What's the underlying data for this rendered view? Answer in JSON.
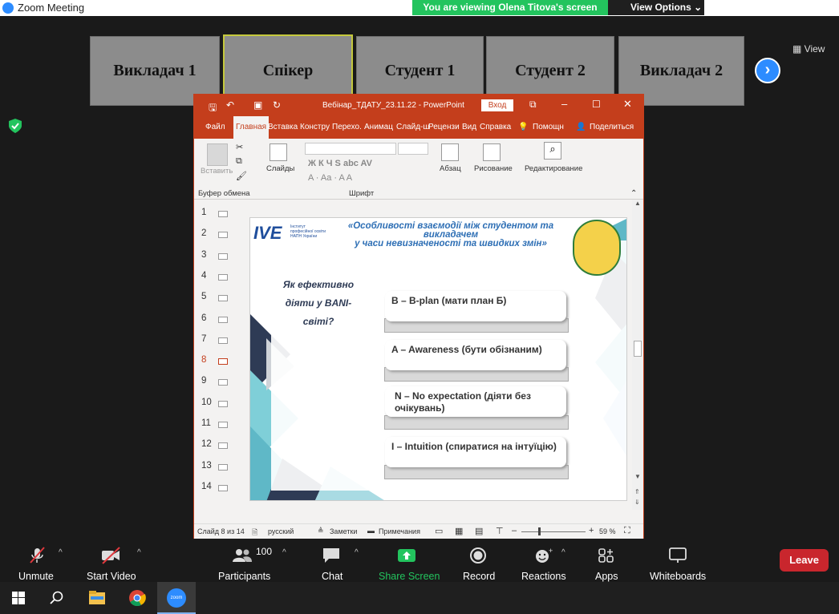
{
  "window": {
    "title": "Zoom Meeting"
  },
  "banner": {
    "viewing": "You are viewing Olena Titova's screen",
    "view_options": "View Options"
  },
  "gallery": {
    "tiles": [
      "Викладач 1",
      "Спікер",
      "Студент 1",
      "Студент 2",
      "Викладач 2"
    ],
    "view_label": "View"
  },
  "ppt": {
    "title": "Вебінар_ТДАТУ_23.11.22  -  PowerPoint",
    "login": "Вход",
    "tabs": [
      "Файл",
      "Главная",
      "Вставка",
      "Констру",
      "Перехо.",
      "Анимац",
      "Слайд-ш",
      "Рецензи",
      "Вид",
      "Справка"
    ],
    "help": "Помощн",
    "share": "Поделиться",
    "ribbon": {
      "paste": "Вставить",
      "clipboard": "Буфер обмена",
      "slides": "Слайды",
      "font": "Шрифт",
      "paragraph": "Абзац",
      "drawing": "Рисование",
      "editing": "Редактирование",
      "font_buttons": "Ж  К  Ч  S  abc  AV",
      "font_size_buttons": "A  ·  Aa  ·  A  A"
    },
    "slide_numbers": [
      "1",
      "2",
      "3",
      "4",
      "5",
      "6",
      "7",
      "8",
      "9",
      "10",
      "11",
      "12",
      "13",
      "14"
    ],
    "current_slide": "8",
    "slide": {
      "logo_text": "IVE",
      "logo_sub": [
        "Інститут",
        "професійної освіти",
        "НАПН України"
      ],
      "title_lines": [
        "«Особливості взаємодії між студентом та",
        "викладачем",
        "у часи невизначеності та швидких змін»"
      ],
      "question": "Як ефективно діяти у BANI-світі?",
      "options": [
        "B – B-plan (мати план Б)",
        "A – Awareness (бути обізнаним)",
        "N – No expectation (діяти без очікувань)",
        "I – Intuition (спиратися на інтуїцію)"
      ]
    },
    "status": {
      "slide_of": "Слайд 8 из 14",
      "language": "русский",
      "notes": "Заметки",
      "comments": "Примечания",
      "zoom": "59 %"
    }
  },
  "toolbar": {
    "unmute": "Unmute",
    "start_video": "Start Video",
    "participants": "Participants",
    "participants_count": "100",
    "chat": "Chat",
    "share_screen": "Share Screen",
    "record": "Record",
    "reactions": "Reactions",
    "apps": "Apps",
    "whiteboards": "Whiteboards",
    "leave": "Leave"
  },
  "colors": {
    "zoom_blue": "#2d8cff",
    "ppt_red": "#c43e1c",
    "share_green": "#23c45e",
    "leave_red": "#c9262d"
  }
}
